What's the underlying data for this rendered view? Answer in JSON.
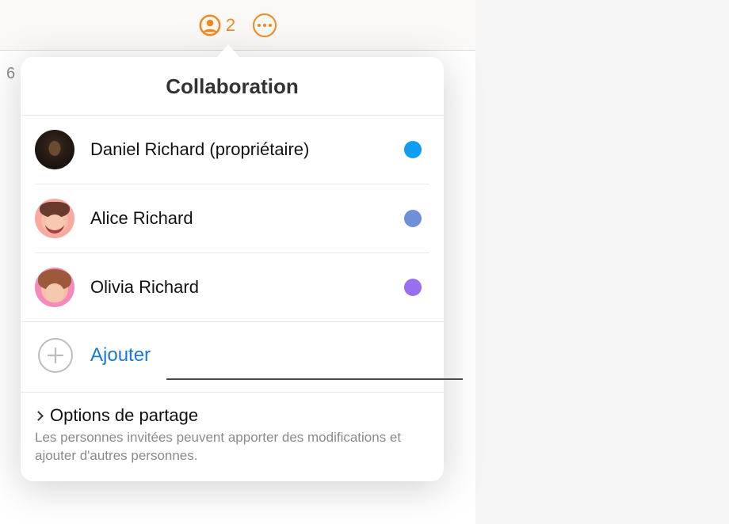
{
  "toolbar": {
    "collab_count": "2"
  },
  "popover": {
    "title": "Collaboration",
    "participants": [
      {
        "name": "Daniel Richard (propriétaire)",
        "color": "#0e9df0"
      },
      {
        "name": "Alice Richard",
        "color": "#6f8fd8"
      },
      {
        "name": "Olivia Richard",
        "color": "#9a6ef0"
      }
    ],
    "add_label": "Ajouter",
    "share": {
      "title": "Options de partage",
      "desc": "Les personnes invitées peuvent apporter des modifications et ajouter d'autres personnes."
    }
  },
  "sheet": {
    "row_label": "6"
  }
}
